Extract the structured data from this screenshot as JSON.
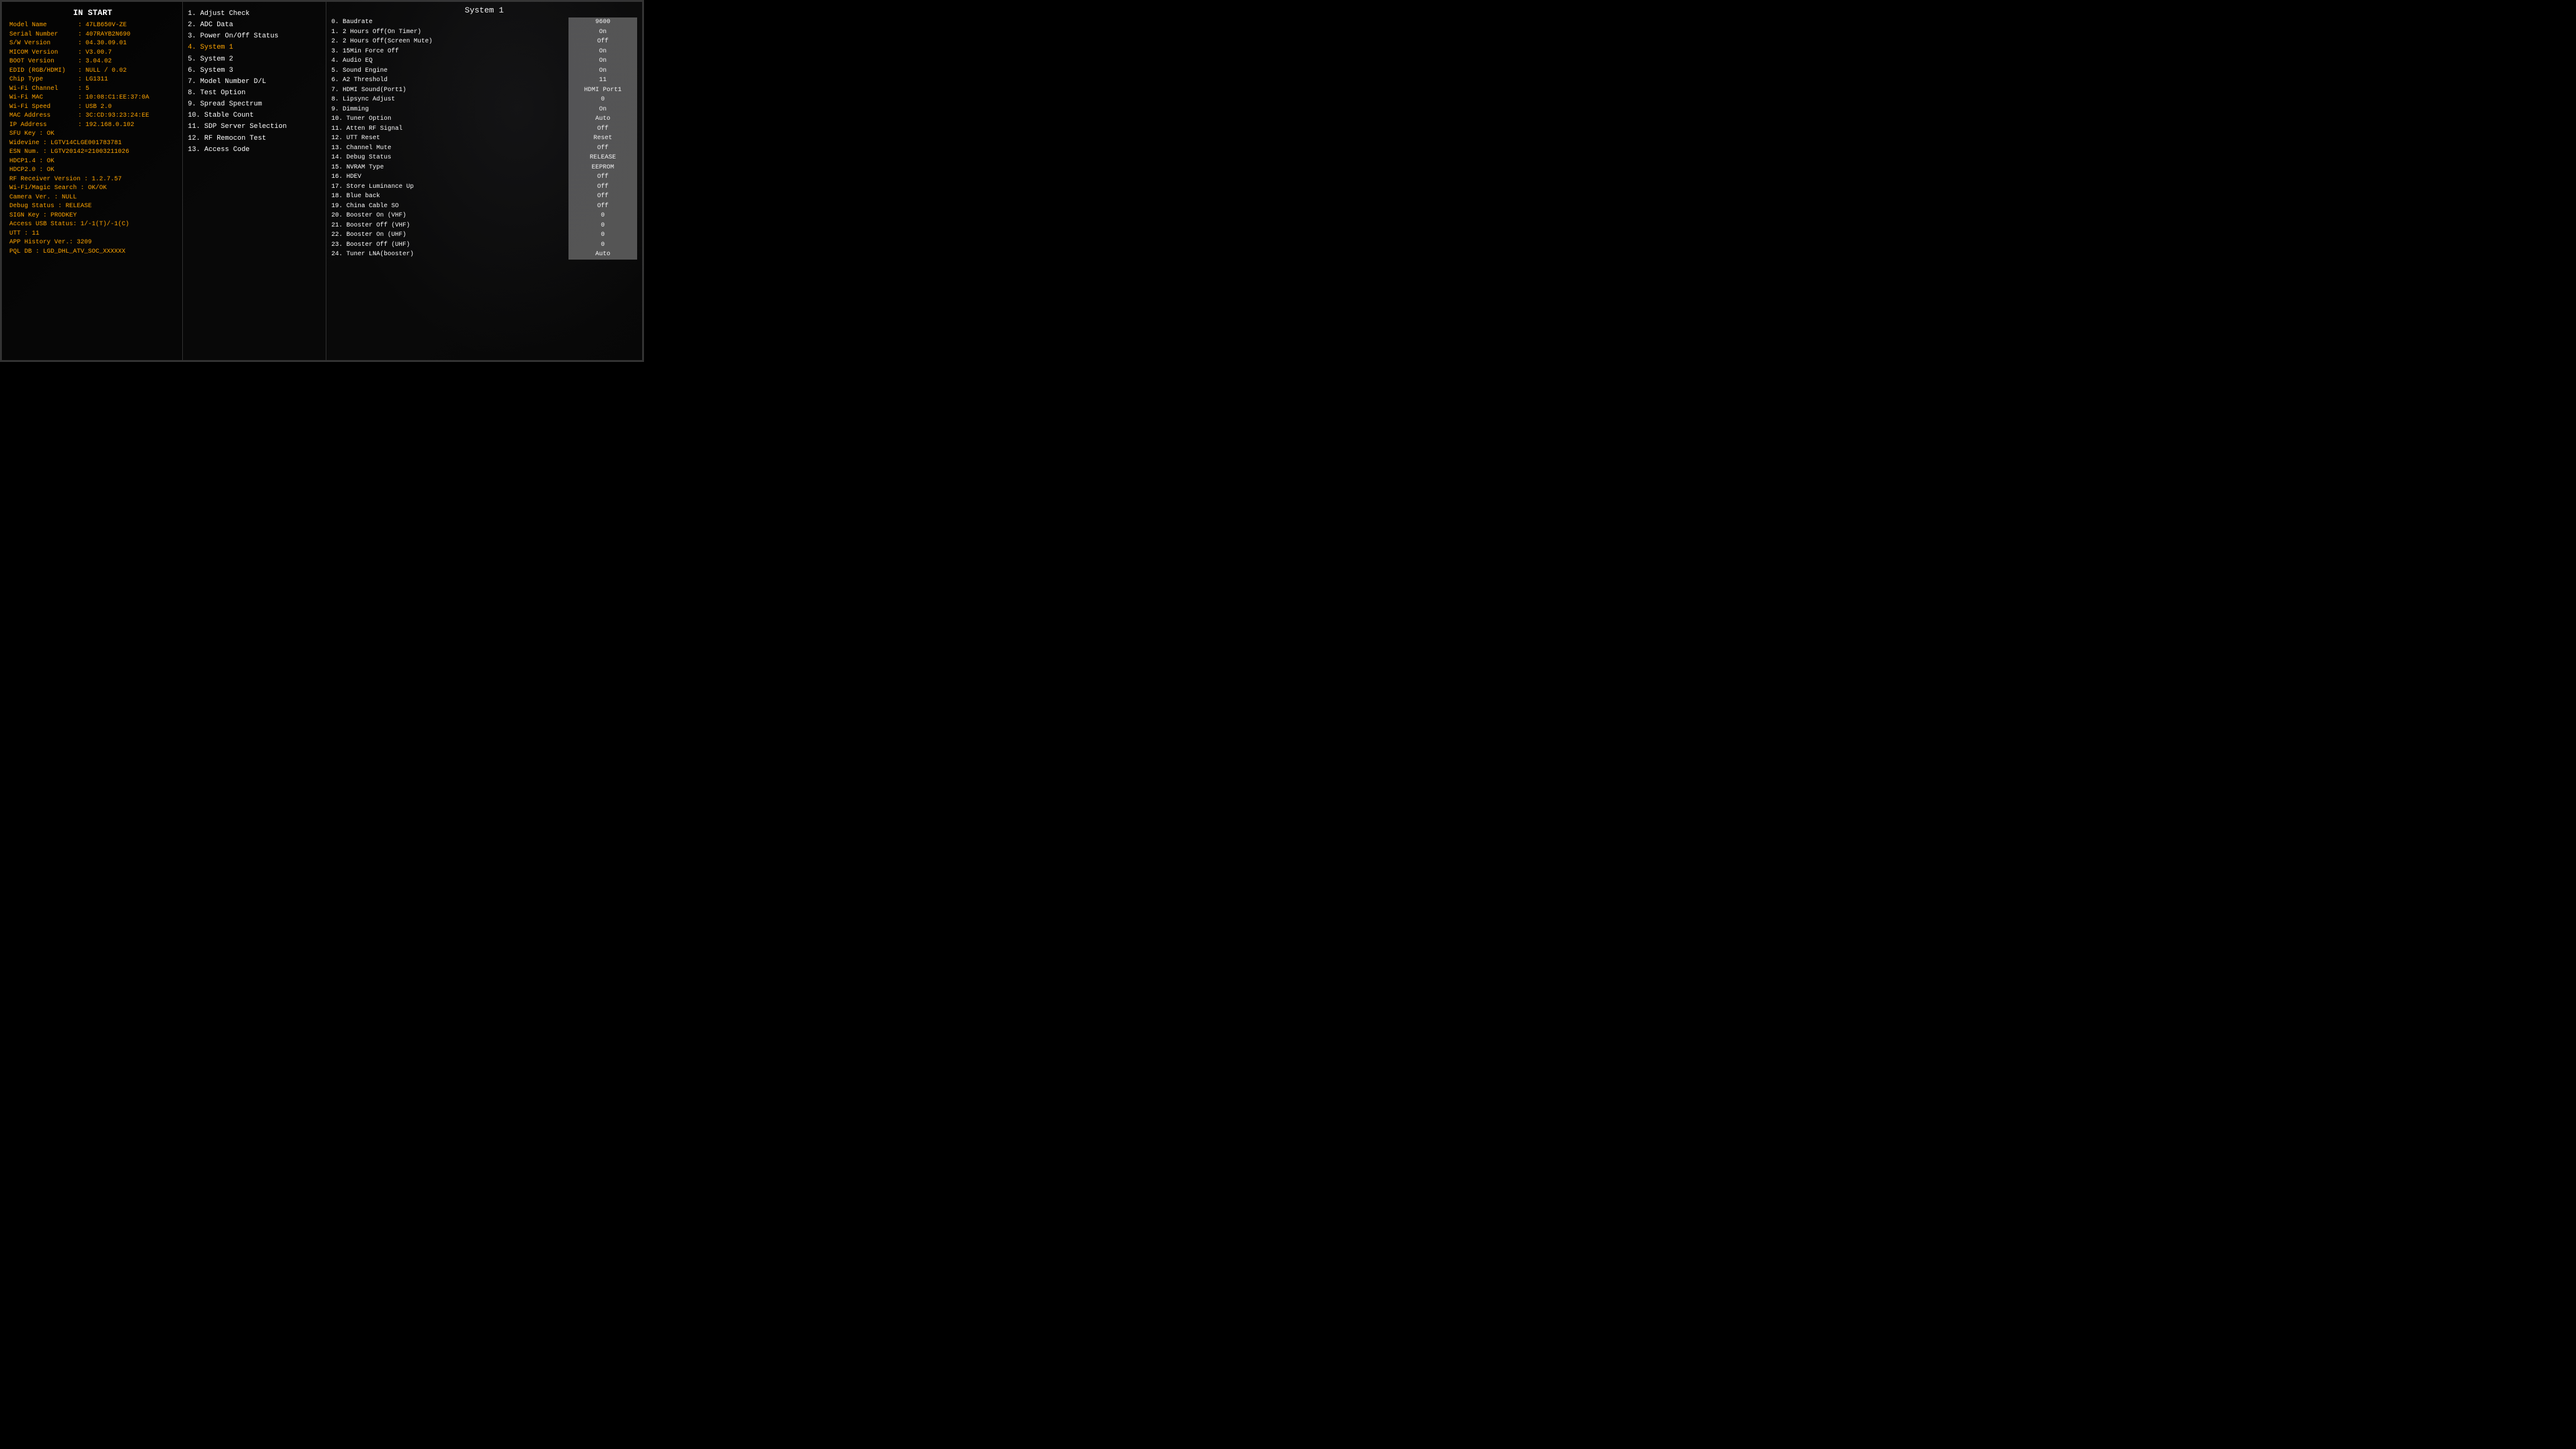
{
  "leftPanel": {
    "title": "IN START",
    "rows": [
      {
        "label": "Model Name",
        "value": ": 47LB650V-ZE"
      },
      {
        "label": "Serial Number",
        "value": ": 407RAYB2N690"
      },
      {
        "label": "S/W Version",
        "value": ": 04.30.09.01"
      },
      {
        "label": "MICOM Version",
        "value": ": V3.00.7"
      },
      {
        "label": "BOOT Version",
        "value": ": 3.04.02"
      },
      {
        "label": "EDID (RGB/HDMI)",
        "value": ": NULL / 0.02"
      },
      {
        "label": "Chip Type",
        "value": ": LG1311"
      },
      {
        "label": "Wi-Fi Channel",
        "value": ": 5"
      },
      {
        "label": "Wi-Fi MAC",
        "value": ": 10:08:C1:EE:37:0A"
      },
      {
        "label": "Wi-Fi Speed",
        "value": ": USB 2.0"
      },
      {
        "label": "MAC Address",
        "value": ": 3C:CD:93:23:24:EE"
      },
      {
        "label": "IP Address",
        "value": ": 192.168.0.102"
      }
    ],
    "plain": [
      "SFU Key : OK",
      "Widevine : LGTV14CLGE001783781",
      "ESN Num. : LGTV20142=21003211026",
      "HDCP1.4          : OK",
      "HDCP2.0          : OK",
      "RF Receiver Version  : 1.2.7.57",
      "Wi-Fi/Magic Search  : OK/OK",
      "Camera Ver.    : NULL",
      "Debug Status     : RELEASE",
      "SIGN Key         : PRODKEY",
      "Access USB Status: 1/-1(T)/-1(C)",
      "UTT : 11",
      "APP History Ver.: 3209",
      "PQL DB : LGD_DHL_ATV_SOC_XXXXXX"
    ]
  },
  "midPanel": {
    "items": [
      {
        "num": "1",
        "label": ". Adjust Check",
        "active": false
      },
      {
        "num": "2",
        "label": ". ADC Data",
        "active": false
      },
      {
        "num": "3",
        "label": ". Power On/Off Status",
        "active": false
      },
      {
        "num": "4",
        "label": ". System 1",
        "active": true
      },
      {
        "num": "5",
        "label": ". System 2",
        "active": false
      },
      {
        "num": "6",
        "label": ". System 3",
        "active": false
      },
      {
        "num": "7",
        "label": ". Model Number D/L",
        "active": false
      },
      {
        "num": "8",
        "label": ". Test Option",
        "active": false
      },
      {
        "num": "9",
        "label": ". Spread Spectrum",
        "active": false
      },
      {
        "num": "10",
        "label": ". Stable Count",
        "active": false
      },
      {
        "num": "11",
        "label": ". SDP Server Selection",
        "active": false
      },
      {
        "num": "12",
        "label": ". RF Remocon Test",
        "active": false
      },
      {
        "num": "13",
        "label": ". Access Code",
        "active": false
      }
    ]
  },
  "rightPanel": {
    "title": "System 1",
    "rows": [
      {
        "label": "0. Baudrate",
        "value": "9600"
      },
      {
        "label": "1. 2 Hours Off(On Timer)",
        "value": "On"
      },
      {
        "label": "2. 2 Hours Off(Screen Mute)",
        "value": "Off"
      },
      {
        "label": "3. 15Min Force Off",
        "value": "On"
      },
      {
        "label": "4. Audio EQ",
        "value": "On"
      },
      {
        "label": "5. Sound Engine",
        "value": "On"
      },
      {
        "label": "6. A2 Threshold",
        "value": "11"
      },
      {
        "label": "7. HDMI Sound(Port1)",
        "value": "HDMI Port1"
      },
      {
        "label": "8. Lipsync Adjust",
        "value": "0"
      },
      {
        "label": "9. Dimming",
        "value": "On"
      },
      {
        "label": "10. Tuner Option",
        "value": "Auto"
      },
      {
        "label": "11. Atten RF Signal",
        "value": "Off"
      },
      {
        "label": "12. UTT Reset",
        "value": "Reset"
      },
      {
        "label": "13. Channel Mute",
        "value": "Off"
      },
      {
        "label": "14. Debug Status",
        "value": "RELEASE"
      },
      {
        "label": "15. NVRAM Type",
        "value": "EEPROM"
      },
      {
        "label": "16. HDEV",
        "value": "Off"
      },
      {
        "label": "17. Store Luminance Up",
        "value": "Off"
      },
      {
        "label": "18. Blue back",
        "value": "Off"
      },
      {
        "label": "19. China Cable SO",
        "value": "Off"
      },
      {
        "label": "20. Booster On (VHF)",
        "value": "0"
      },
      {
        "label": "21. Booster Off (VHF)",
        "value": "0"
      },
      {
        "label": "22. Booster On (UHF)",
        "value": "0"
      },
      {
        "label": "23. Booster Off (UHF)",
        "value": "0"
      },
      {
        "label": "24. Tuner LNA(booster)",
        "value": "Auto"
      }
    ]
  }
}
